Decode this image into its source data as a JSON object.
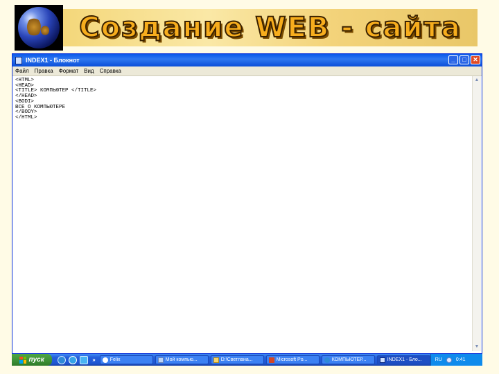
{
  "banner": {
    "title": "Создание WEB - сайта"
  },
  "window": {
    "title": "INDEX1 - Блокнот",
    "controls": {
      "minimize": "_",
      "maximize": "□",
      "close": "✕"
    },
    "menu": [
      "Файл",
      "Правка",
      "Формат",
      "Вид",
      "Справка"
    ],
    "content": "<HTML>\n<HEAD>\n<TITLE> КОМПЬЮТЕР </TITLE>\n</HEAD>\n<BODI>\nВСЕ О КОМПЬЮТЕРЕ\n</BODY>\n</HTML>"
  },
  "taskbar": {
    "start_label": "пуск",
    "more_label": "»",
    "tasks": [
      {
        "label": "Felix",
        "icon": "paw-icon"
      },
      {
        "label": "Мой компью...",
        "icon": "computer-icon"
      },
      {
        "label": "D:\\Светлана...",
        "icon": "folder-icon"
      },
      {
        "label": "Microsoft Po...",
        "icon": "powerpoint-icon"
      },
      {
        "label": "КОМПЬЮТЕР...",
        "icon": "browser-icon"
      },
      {
        "label": "INDEX1 - Бло...",
        "icon": "notepad-icon"
      }
    ],
    "language": "RU",
    "time": "0:41"
  },
  "colors": {
    "banner_text": "#f7ad1d",
    "titlebar": "#0a58ea",
    "taskbar": "#245edb",
    "start_button": "#3c8f35",
    "page_background": "#fffbe6"
  }
}
